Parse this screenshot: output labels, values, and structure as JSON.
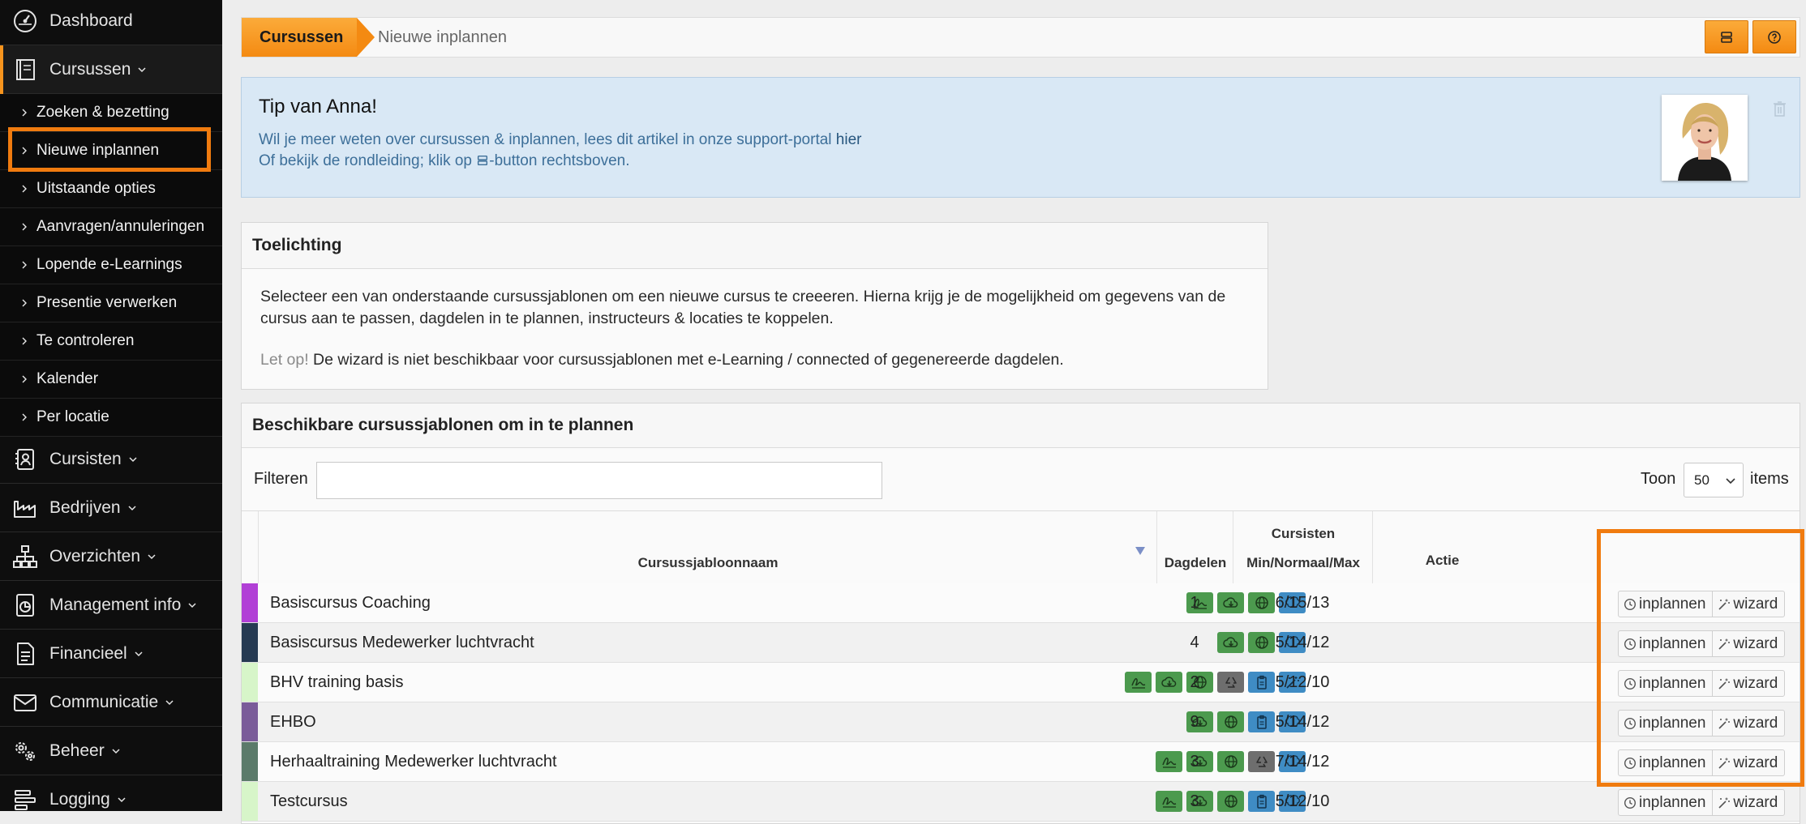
{
  "sidebar": {
    "top_items": [
      {
        "label": "Dashboard",
        "icon": "dashboard-icon"
      },
      {
        "label": "Cursussen",
        "icon": "book-icon"
      }
    ],
    "sub_items": [
      "Zoeken & bezetting",
      "Nieuwe inplannen",
      "Uitstaande opties",
      "Aanvragen/annuleringen",
      "Lopende e-Learnings",
      "Presentie verwerken",
      "Te controleren",
      "Kalender",
      "Per locatie"
    ],
    "bottom_items": [
      {
        "label": "Cursisten",
        "icon": "contact-card-icon"
      },
      {
        "label": "Bedrijven",
        "icon": "factory-icon"
      },
      {
        "label": "Overzichten",
        "icon": "org-chart-icon"
      },
      {
        "label": "Management info",
        "icon": "pie-chart-icon"
      },
      {
        "label": "Financieel",
        "icon": "document-icon"
      },
      {
        "label": "Communicatie",
        "icon": "envelope-icon"
      },
      {
        "label": "Beheer",
        "icon": "gears-icon"
      },
      {
        "label": "Logging",
        "icon": "list-icon"
      }
    ]
  },
  "breadcrumb": {
    "section": "Cursussen",
    "current": "Nieuwe inplannen"
  },
  "tip": {
    "title": "Tip van Anna!",
    "line1": "Wil je meer weten over cursussen & inplannen, lees dit artikel in onze support-portal ",
    "line1_link": "hier",
    "line2_pre": "Of bekijk de rondleiding; klik op ",
    "line2_post": "-button rechtsboven."
  },
  "toelichting": {
    "title": "Toelichting",
    "paragraph": "Selecteer een van onderstaande cursussjablonen om een nieuwe cursus te creeeren. Hierna krijg je de mogelijkheid om gegevens van de cursus aan te passen, dagdelen in te plannen, instructeurs & locaties te koppelen.",
    "letop_label": "Let op!",
    "letop_text": " De wizard is niet beschikbaar voor cursussjablonen met e-Learning / connected of gegenereerde dagdelen."
  },
  "templates": {
    "title": "Beschikbare cursussjablonen om in te plannen",
    "filter_label": "Filteren",
    "filter_value": "",
    "toon_label": "Toon",
    "toon_value": "50",
    "items_label": "items",
    "columns": {
      "name": "Cursussjabloonnaam",
      "dagdelen": "Dagdelen",
      "cursisten_1": "Cursisten",
      "cursisten_2": "Min/Normaal/Max",
      "actie": "Actie"
    },
    "action_inplannen": "inplannen",
    "action_wizard": "wizard",
    "rows": [
      {
        "name": "Basiscursus Coaching",
        "color": "#b13fd6",
        "dagdelen": "1",
        "cursisten": "6/15/13",
        "badges": [
          "green:sign",
          "green:cloud",
          "green:globe",
          "blue:brain"
        ]
      },
      {
        "name": "Basiscursus Medewerker luchtvracht",
        "color": "#263a52",
        "dagdelen": "4",
        "cursisten": "5/14/12",
        "badges": [
          "green:cloud",
          "green:globe",
          "blue:brain"
        ]
      },
      {
        "name": "BHV training basis",
        "color": "#d7f5c9",
        "dagdelen": "2",
        "cursisten": "5/12/10",
        "badges": [
          "green:sign",
          "green:cloud",
          "green:globe",
          "gray:recycle",
          "blue:clipboard",
          "blue:wand"
        ]
      },
      {
        "name": "EHBO",
        "color": "#7a5c99",
        "dagdelen": "9",
        "cursisten": "5/14/12",
        "badges": [
          "green:cloud",
          "green:globe",
          "blue:clipboard",
          "blue:brain"
        ]
      },
      {
        "name": "Herhaaltraining Medewerker luchtvracht",
        "color": "#5b7a6a",
        "dagdelen": "3",
        "cursisten": "7/14/12",
        "badges": [
          "green:sign",
          "green:cloud",
          "green:globe",
          "gray:recycle",
          "blue:brain"
        ]
      },
      {
        "name": "Testcursus",
        "color": "#d7f5c9",
        "dagdelen": "3",
        "cursisten": "5/12/10",
        "badges": [
          "green:sign",
          "green:cloud",
          "green:globe",
          "blue:clipboard",
          "blue:brain"
        ]
      }
    ]
  },
  "colors": {
    "accent": "#f48a12",
    "highlight": "#f07b0f",
    "sidebar_bg": "#0e0e0e",
    "tip_bg": "#d9e8f5"
  }
}
